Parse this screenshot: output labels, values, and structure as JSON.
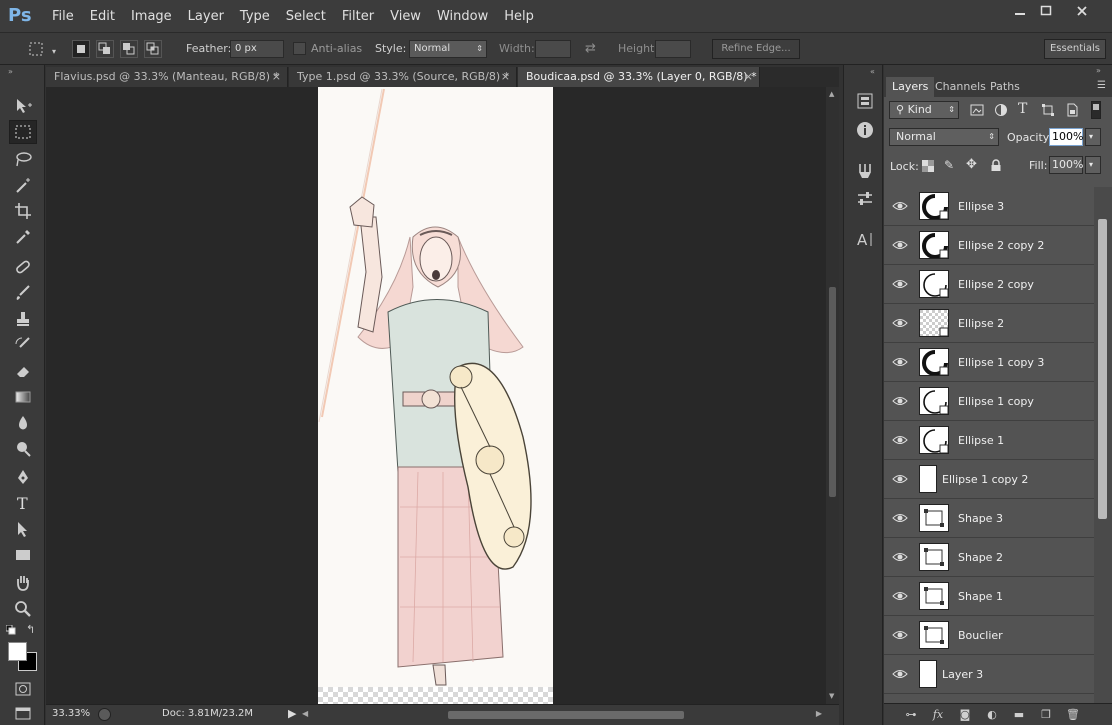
{
  "app": {
    "logo": "Ps"
  },
  "menu": [
    "File",
    "Edit",
    "Image",
    "Layer",
    "Type",
    "Select",
    "Filter",
    "View",
    "Window",
    "Help"
  ],
  "options": {
    "feather_label": "Feather:",
    "feather_value": "0 px",
    "antialias_label": "Anti-alias",
    "style_label": "Style:",
    "style_value": "Normal",
    "width_label": "Width:",
    "height_label": "Height:",
    "refine_edge": "Refine Edge...",
    "workspace": "Essentials"
  },
  "tabs": [
    {
      "label": "Flavius.psd @ 33.3% (Manteau, RGB/8) *",
      "active": false
    },
    {
      "label": "Type 1.psd @ 33.3% (Source, RGB/8) *",
      "active": false
    },
    {
      "label": "Boudicaa.psd @ 33.3% (Layer 0, RGB/8) *",
      "active": true
    }
  ],
  "status": {
    "zoom": "33.33%",
    "doc": "Doc: 3.81M/23.2M"
  },
  "layers_panel": {
    "tabs": [
      "Layers",
      "Channels",
      "Paths"
    ],
    "filter_kind": "Kind",
    "blend_mode": "Normal",
    "opacity_label": "Opacity:",
    "opacity_value": "100%",
    "lock_label": "Lock:",
    "fill_label": "Fill:",
    "fill_value": "100%",
    "layers": [
      {
        "name": "Ellipse 3",
        "thumb": "ellipse-thick"
      },
      {
        "name": "Ellipse 2 copy 2",
        "thumb": "ellipse-thick"
      },
      {
        "name": "Ellipse 2 copy",
        "thumb": "ellipse-thin"
      },
      {
        "name": "Ellipse 2",
        "thumb": "checker"
      },
      {
        "name": "Ellipse 1 copy 3",
        "thumb": "ellipse-thick"
      },
      {
        "name": "Ellipse 1 copy",
        "thumb": "ellipse-thin"
      },
      {
        "name": "Ellipse 1",
        "thumb": "ellipse-thin"
      },
      {
        "name": "Ellipse 1 copy 2",
        "thumb": "blank"
      },
      {
        "name": "Shape 3",
        "thumb": "shape"
      },
      {
        "name": "Shape 2",
        "thumb": "shape"
      },
      {
        "name": "Shape 1",
        "thumb": "shape"
      },
      {
        "name": "Bouclier",
        "thumb": "shape"
      },
      {
        "name": "Layer 3",
        "thumb": "blank"
      }
    ]
  },
  "colors": {
    "accent": "#7fb6e8",
    "panel_bg": "#535353",
    "canvas_bg": "#282828"
  }
}
